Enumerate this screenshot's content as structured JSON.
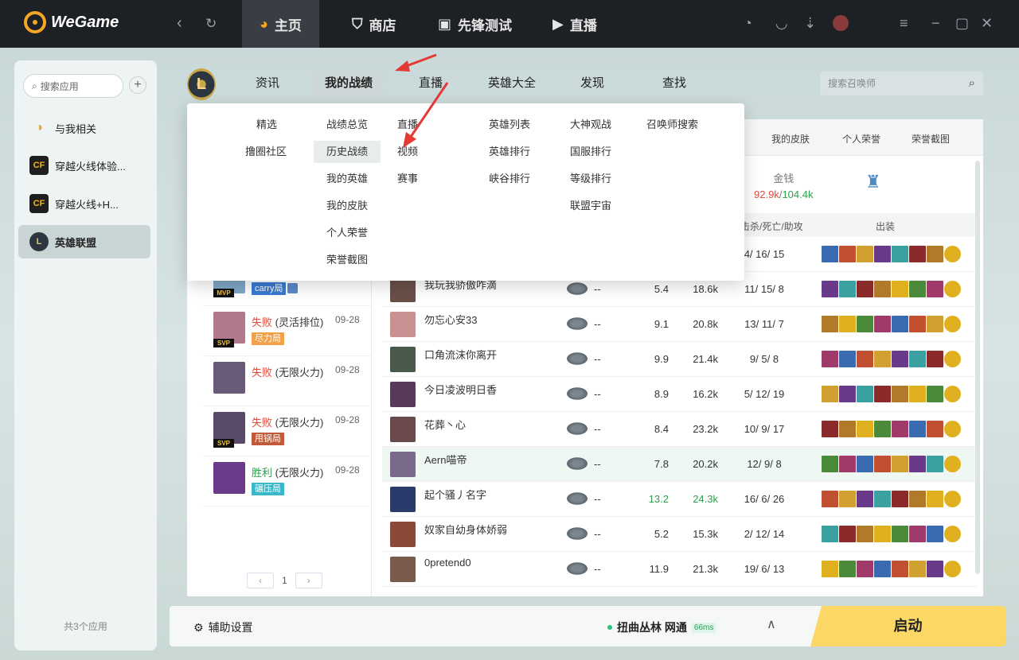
{
  "app": {
    "name": "WeGame"
  },
  "topnav": {
    "tabs": [
      {
        "label": "主页",
        "icon": "pacman-icon"
      },
      {
        "label": "商店",
        "icon": "bag-icon"
      },
      {
        "label": "先锋测试",
        "icon": "pioneer-icon"
      },
      {
        "label": "直播",
        "icon": "play-icon"
      }
    ]
  },
  "sidebar": {
    "search_placeholder": "搜索应用",
    "items": [
      {
        "label": "与我相关"
      },
      {
        "label": "穿越火线体验..."
      },
      {
        "label": "穿越火线+H..."
      },
      {
        "label": "英雄联盟"
      }
    ],
    "footer": "共3个应用"
  },
  "lol": {
    "tabs": [
      "资讯",
      "我的战绩",
      "直播",
      "英雄大全",
      "发现",
      "查找"
    ],
    "search_placeholder": "搜索召唤师",
    "profile_tabs": [
      "我的皮肤",
      "个人荣誉",
      "荣誉截图"
    ],
    "dropdown": {
      "col1": [
        "精选",
        "撸圈社区"
      ],
      "col2": [
        "战绩总览",
        "历史战绩",
        "我的英雄",
        "我的皮肤",
        "个人荣誉",
        "荣誉截图"
      ],
      "col3": [
        "直播",
        "视频",
        "赛事"
      ],
      "col4": [
        "英雄列表",
        "英雄排行",
        "峡谷排行"
      ],
      "col5": [
        "大神观战",
        "国服排行",
        "等级排行",
        "联盟宇宙"
      ],
      "col6": [
        "召唤师搜索"
      ]
    },
    "stats": {
      "gold_label": "金钱",
      "gold_a": "92.9k",
      "gold_sep": "/",
      "gold_b": "104.4k"
    },
    "table_headers": {
      "kda": "击杀/死亡/助攻",
      "items": "出装"
    },
    "matches": [
      {
        "result": "胜利",
        "mode": "(无限火力)",
        "date": "",
        "tag": ""
      },
      {
        "result": "胜利",
        "mode": "(无限火力)",
        "date": "",
        "tag": "碾压局"
      },
      {
        "result": "胜利",
        "mode": "(灵活排位)",
        "date": "09-28",
        "tag": "carry局"
      },
      {
        "result": "失败",
        "mode": "(灵活排位)",
        "date": "09-28",
        "tag": "尽力局"
      },
      {
        "result": "失败",
        "mode": "(无限火力)",
        "date": "09-28",
        "tag": ""
      },
      {
        "result": "失败",
        "mode": "(无限火力)",
        "date": "09-28",
        "tag": "甩锅局"
      },
      {
        "result": "胜利",
        "mode": "(无限火力)",
        "date": "09-28",
        "tag": "碾压局"
      }
    ],
    "pager": {
      "page": "1"
    },
    "players": [
      {
        "name": "青春亦吾辈少年",
        "dash": "--",
        "score": "6.8",
        "gold": "15.9k",
        "kda": "4/ 16/ 15"
      },
      {
        "name": "我玩我骄傲咋滴",
        "dash": "--",
        "score": "5.4",
        "gold": "18.6k",
        "kda": "11/ 15/ 8"
      },
      {
        "name": "勿忘心安33",
        "dash": "--",
        "score": "9.1",
        "gold": "20.8k",
        "kda": "13/ 11/ 7"
      },
      {
        "name": "口角流沫你离开",
        "dash": "--",
        "score": "9.9",
        "gold": "21.4k",
        "kda": "9/ 5/ 8"
      },
      {
        "name": "今日凌波明日香",
        "dash": "--",
        "score": "8.9",
        "gold": "16.2k",
        "kda": "5/ 12/ 19"
      },
      {
        "name": "花葬丶心",
        "dash": "--",
        "score": "8.4",
        "gold": "23.2k",
        "kda": "10/ 9/ 17"
      },
      {
        "name": "Aern喵帝",
        "dash": "--",
        "score": "7.8",
        "gold": "20.2k",
        "kda": "12/ 9/ 8"
      },
      {
        "name": "起个骚丿名字",
        "dash": "--",
        "score": "13.2",
        "gold": "24.3k",
        "kda": "16/ 6/ 26"
      },
      {
        "name": "奴家自幼身体娇弱",
        "dash": "--",
        "score": "5.2",
        "gold": "15.3k",
        "kda": "2/ 12/ 14"
      },
      {
        "name": "0pretend0",
        "dash": "--",
        "score": "11.9",
        "gold": "21.3k",
        "kda": "19/ 6/ 13"
      }
    ]
  },
  "bottom": {
    "assist_label": "辅助设置",
    "server_label": "扭曲丛林 网通",
    "ping": "66ms",
    "launch_label": "启动"
  },
  "colors": {
    "win": "#2e9e4f",
    "lose": "#e24b3b",
    "launch": "#fbd865",
    "accent": "#f5a623"
  }
}
